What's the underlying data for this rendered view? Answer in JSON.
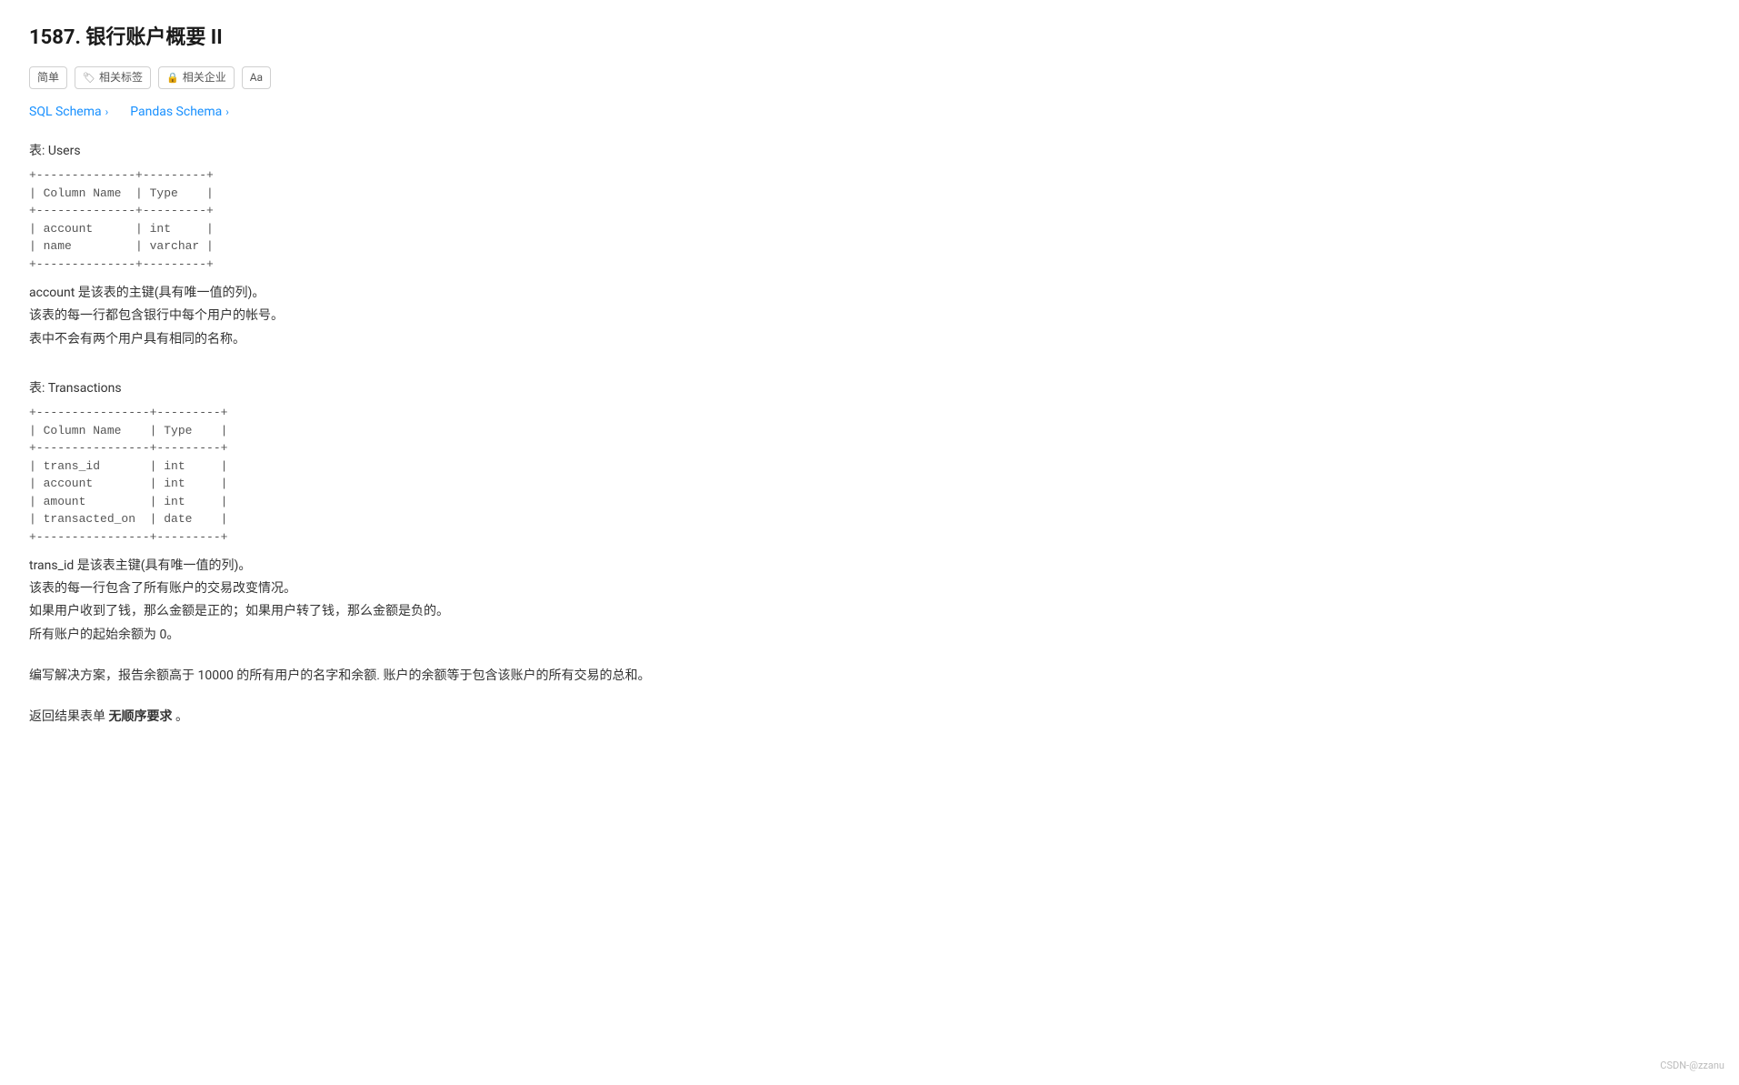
{
  "page": {
    "title": "1587. 银行账户概要 II",
    "tags": [
      {
        "label": "简单",
        "icon": ""
      },
      {
        "label": "相关标签",
        "icon": "🏷"
      },
      {
        "label": "相关企业",
        "icon": "🔒"
      },
      {
        "label": "Aa",
        "icon": ""
      }
    ],
    "schemaLinks": [
      {
        "label": "SQL Schema",
        "chevron": "›"
      },
      {
        "label": "Pandas Schema",
        "chevron": "›"
      }
    ],
    "usersTable": {
      "sectionLabel": "表: Users",
      "schemaText": "+--------------+---------+\n| Column Name  | Type    |\n+--------------+---------+\n| account      | int     |\n| name         | varchar |\n+--------------+---------+",
      "description": [
        "account 是该表的主键(具有唯一值的列)。",
        "该表的每一行都包含银行中每个用户的帐号。",
        "表中不会有两个用户具有相同的名称。"
      ]
    },
    "transactionsTable": {
      "sectionLabel": "表: Transactions",
      "schemaText": "+----------------+---------+\n| Column Name    | Type    |\n+----------------+---------+\n| trans_id       | int     |\n| account        | int     |\n| amount         | int     |\n| transacted_on  | date    |\n+----------------+---------+",
      "description": [
        "trans_id 是该表主键(具有唯一值的列)。",
        "该表的每一行包含了所有账户的交易改变情况。",
        "如果用户收到了钱，那么金额是正的；如果用户转了钱，那么金额是负的。",
        "所有账户的起始余额为 0。"
      ]
    },
    "problemStatement": "编写解决方案，报告余额高于 10000 的所有用户的名字和余额. 账户的余额等于包含该账户的所有交易的总和。",
    "returnNote": "返回结果表单 ",
    "noOrder": "无顺序要求",
    "returnNoteSuffix": " 。",
    "watermark": "CSDN-@zzanu"
  }
}
